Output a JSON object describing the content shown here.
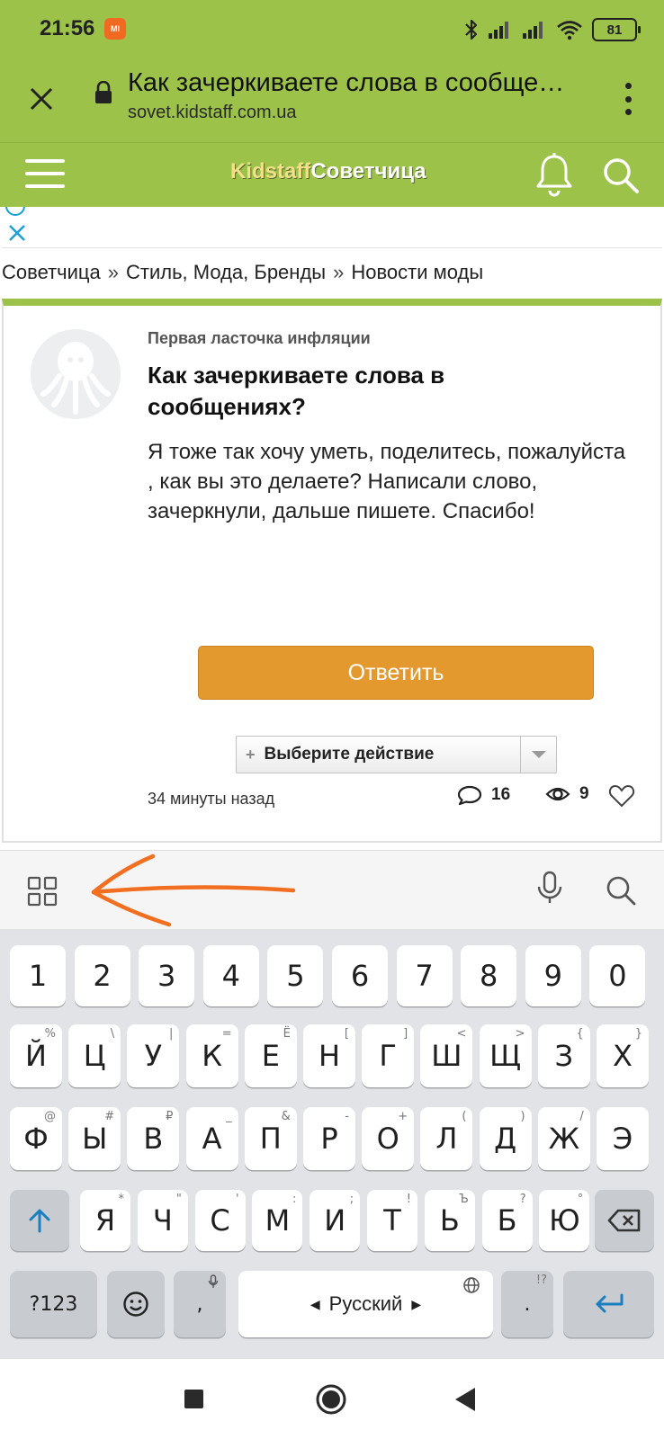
{
  "status_bar": {
    "time": "21:56",
    "mi_badge": "MI",
    "battery": "81"
  },
  "browser": {
    "title": "Как зачеркиваете слова в сообще…",
    "url": "sovet.kidstaff.com.ua"
  },
  "site": {
    "logo_part1": "Kidstaff",
    "logo_part2": "Советчица"
  },
  "breadcrumb": {
    "items": [
      "Советчица",
      "Стиль, Мода, Бренды",
      "Новости моды"
    ],
    "separator": "»"
  },
  "post": {
    "topic": "Первая ласточка инфляции",
    "title": "Как зачеркиваете слова в сообщениях?",
    "body": "Я тоже так хочу уметь, поделитесь, пожалуйста , как вы это делаете? Написали слово, зачеркнули, дальше пишете. Спасибо!",
    "reply_label": "Ответить",
    "action_plus": "+",
    "action_label": "Выберите действие",
    "time": "34 минуты назад",
    "comments": "16",
    "views": "9"
  },
  "keyboard": {
    "digits": [
      "1",
      "2",
      "3",
      "4",
      "5",
      "6",
      "7",
      "8",
      "9",
      "0"
    ],
    "row1": [
      "Й",
      "Ц",
      "У",
      "К",
      "Е",
      "Н",
      "Г",
      "Ш",
      "Щ",
      "З",
      "Х"
    ],
    "row1_hints": [
      "%",
      "\\",
      "|",
      "=",
      "Ё",
      "[",
      "]",
      "<",
      ">",
      "{",
      "}"
    ],
    "row2": [
      "Ф",
      "Ы",
      "В",
      "А",
      "П",
      "Р",
      "О",
      "Л",
      "Д",
      "Ж",
      "Э"
    ],
    "row2_hints": [
      "@",
      "#",
      "₽",
      "_",
      "&",
      "-",
      "+",
      "(",
      ")",
      "/",
      ""
    ],
    "row3": [
      "Я",
      "Ч",
      "С",
      "М",
      "И",
      "Т",
      "Ь",
      "Б",
      "Ю"
    ],
    "row3_hints": [
      "*",
      "\"",
      "'",
      ":",
      ";",
      "!",
      "Ъ",
      "?",
      "°"
    ],
    "symbols_label": "?123",
    "comma": ",",
    "space_label": "Русский",
    "period": ".",
    "period_hint": "!?"
  },
  "colors": {
    "brand_green": "#9dc24a",
    "reply_orange": "#e4992e",
    "annotation_arrow": "#f26f21",
    "link_blue": "#1a9fd6"
  }
}
